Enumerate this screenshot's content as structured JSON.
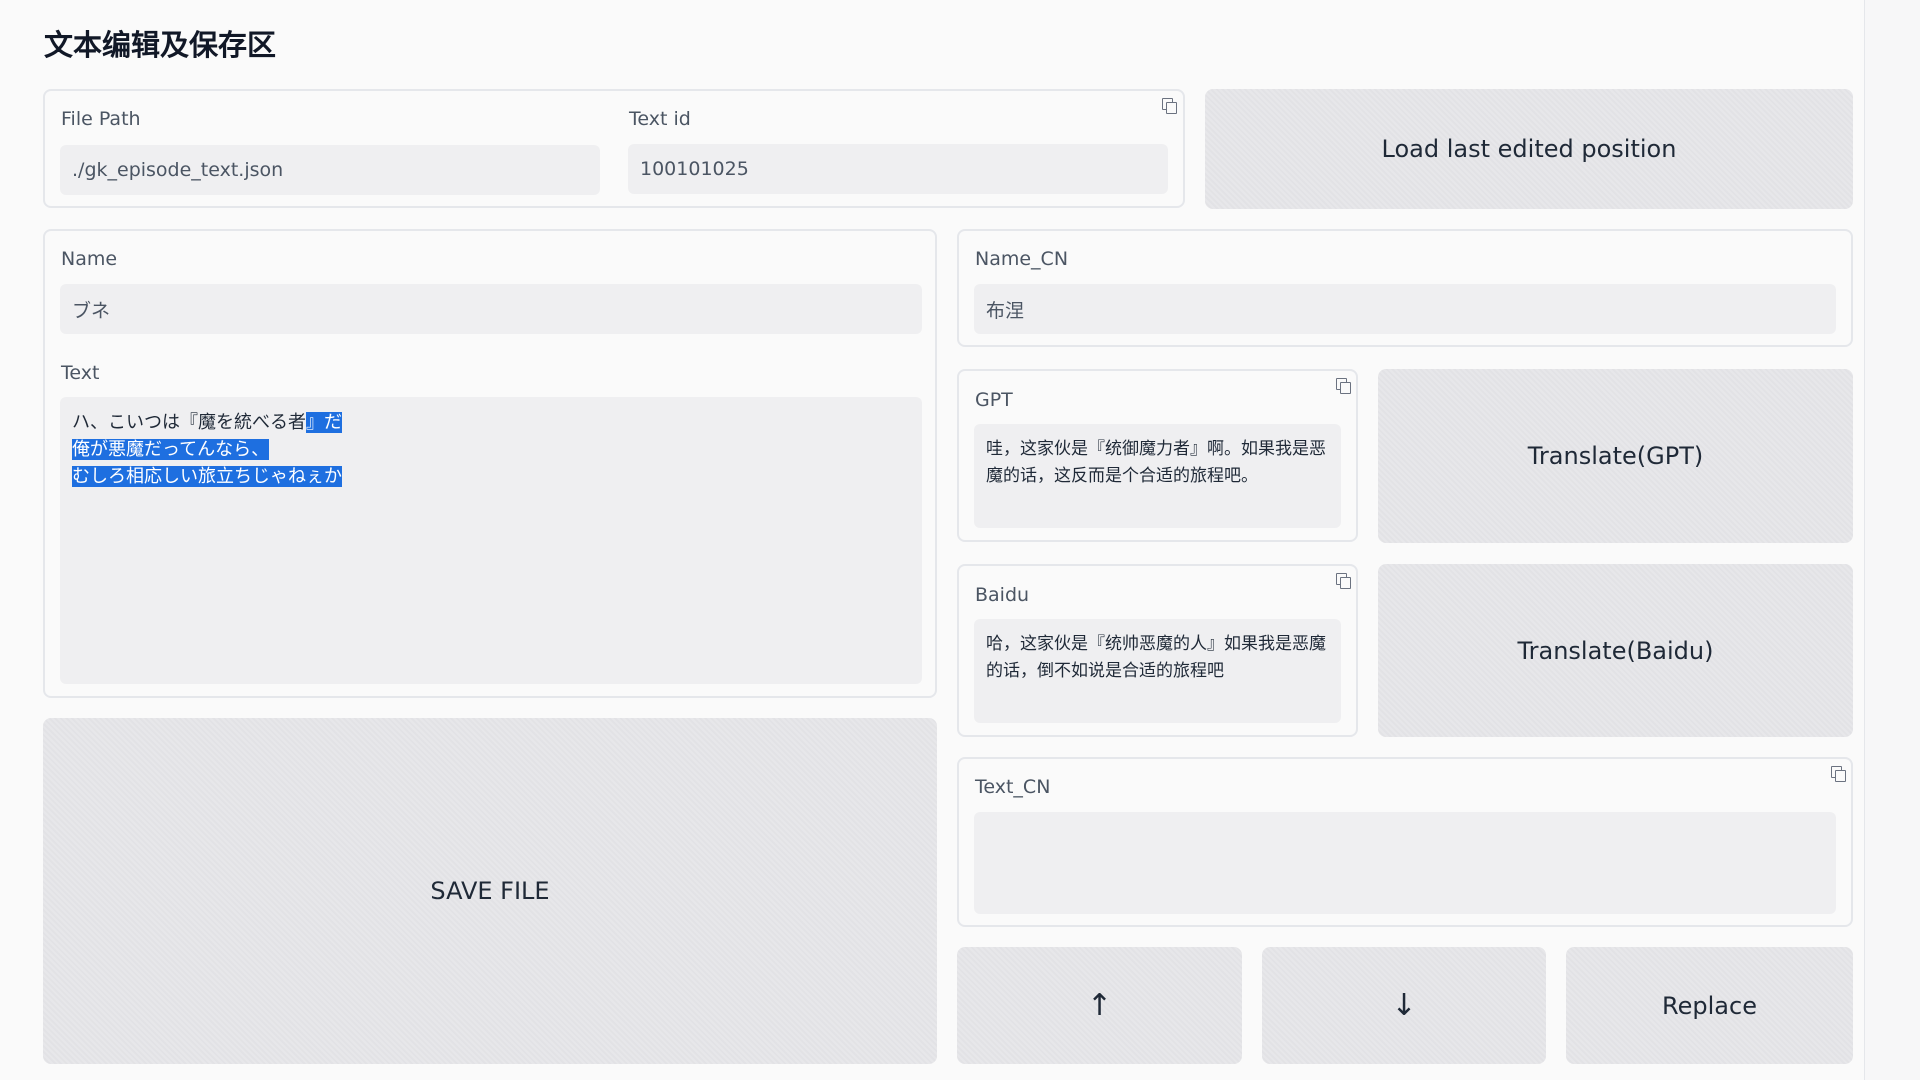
{
  "page": {
    "title": "文本编辑及保存区"
  },
  "file_section": {
    "file_path_label": "File Path",
    "file_path_value": "./gk_episode_text.json",
    "text_id_label": "Text id",
    "text_id_value": "100101025"
  },
  "load_button_label": "Load last edited position",
  "editor": {
    "name_label": "Name",
    "name_value": "ブネ",
    "text_label": "Text",
    "text_line1_plain": "ハ、こいつは『魔を統べる者",
    "text_line1_selected": "』だ",
    "text_line2_selected": "俺が悪魔だってんなら、",
    "text_line3_selected": "むしろ相応しい旅立ちじゃねぇか"
  },
  "name_cn": {
    "label": "Name_CN",
    "value": "布涅"
  },
  "gpt": {
    "label": "GPT",
    "value": "哇，这家伙是『统御魔力者』啊。如果我是恶魔的话，这反而是个合适的旅程吧。"
  },
  "baidu": {
    "label": "Baidu",
    "value": "哈，这家伙是『统帅恶魔的人』如果我是恶魔的话，倒不如说是合适的旅程吧"
  },
  "translate_gpt_label": "Translate(GPT)",
  "translate_baidu_label": "Translate(Baidu)",
  "text_cn": {
    "label": "Text_CN",
    "value": ""
  },
  "save_button_label": "SAVE FILE",
  "nav": {
    "up_label": "↑",
    "down_label": "↓",
    "replace_label": "Replace"
  },
  "icons": {
    "copy": "copy-icon"
  }
}
